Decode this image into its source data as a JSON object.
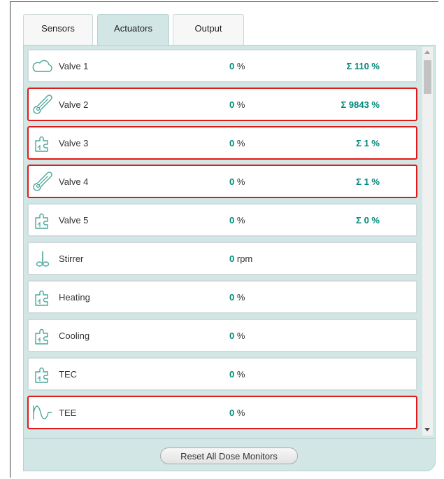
{
  "tabs": [
    {
      "label": "Sensors",
      "active": false
    },
    {
      "label": "Actuators",
      "active": true
    },
    {
      "label": "Output",
      "active": false
    }
  ],
  "actuators": [
    {
      "name": "Valve 1",
      "icon": "cloud-icon",
      "value": "0",
      "unit": "%",
      "sum": "Σ 110 %",
      "highlighted": false
    },
    {
      "name": "Valve 2",
      "icon": "thermometer-icon",
      "value": "0",
      "unit": "%",
      "sum": "Σ 9843 %",
      "highlighted": true
    },
    {
      "name": "Valve 3",
      "icon": "puzzle-icon",
      "value": "0",
      "unit": "%",
      "sum": "Σ 1 %",
      "highlighted": true
    },
    {
      "name": "Valve 4",
      "icon": "thermometer-icon",
      "value": "0",
      "unit": "%",
      "sum": "Σ 1 %",
      "highlighted": true
    },
    {
      "name": "Valve 5",
      "icon": "puzzle-icon",
      "value": "0",
      "unit": "%",
      "sum": "Σ 0 %",
      "highlighted": false
    },
    {
      "name": "Stirrer",
      "icon": "stirrer-icon",
      "value": "0",
      "unit": "rpm",
      "sum": "",
      "highlighted": false
    },
    {
      "name": "Heating",
      "icon": "puzzle-icon",
      "value": "0",
      "unit": "%",
      "sum": "",
      "highlighted": false
    },
    {
      "name": "Cooling",
      "icon": "puzzle-icon",
      "value": "0",
      "unit": "%",
      "sum": "",
      "highlighted": false
    },
    {
      "name": "TEC",
      "icon": "puzzle-icon",
      "value": "0",
      "unit": "%",
      "sum": "",
      "highlighted": false
    },
    {
      "name": "TEE",
      "icon": "wave-icon",
      "value": "0",
      "unit": "%",
      "sum": "",
      "highlighted": true
    }
  ],
  "footer": {
    "reset_label": "Reset All Dose Monitors"
  },
  "colors": {
    "accent": "#00897b",
    "highlight_border": "#e01a1a",
    "panel_bg": "#d3e6e6"
  }
}
